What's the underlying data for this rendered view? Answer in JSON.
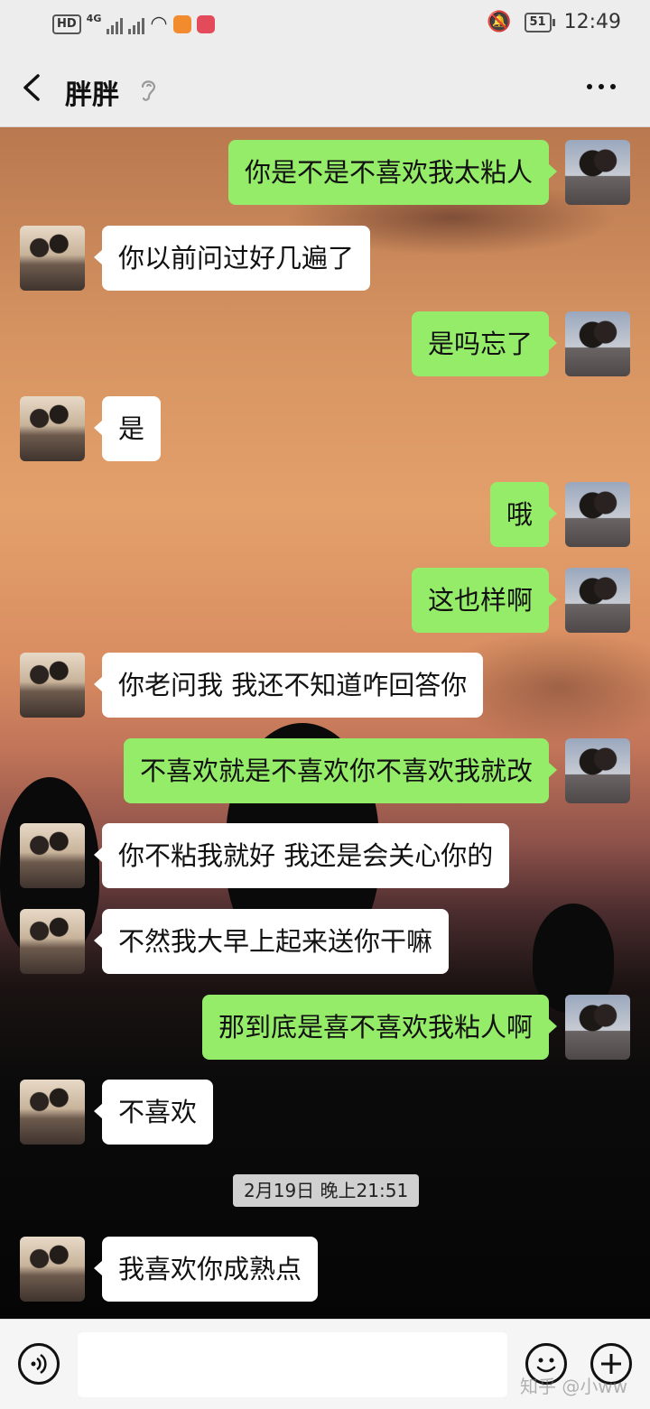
{
  "status_bar": {
    "hd": "HD",
    "network": "4G",
    "battery": "51",
    "time": "12:49"
  },
  "header": {
    "title": "胖胖"
  },
  "messages": [
    {
      "side": "me",
      "text": "你是不是不喜欢我太粘人"
    },
    {
      "side": "other",
      "text": "你以前问过好几遍了"
    },
    {
      "side": "me",
      "text": "是吗忘了"
    },
    {
      "side": "other",
      "text": "是"
    },
    {
      "side": "me",
      "text": "哦"
    },
    {
      "side": "me",
      "text": "这也样啊"
    },
    {
      "side": "other",
      "text": "你老问我 我还不知道咋回答你"
    },
    {
      "side": "me",
      "text": "不喜欢就是不喜欢你不喜欢我就改"
    },
    {
      "side": "other",
      "text": "你不粘我就好 我还是会关心你的"
    },
    {
      "side": "other",
      "text": "不然我大早上起来送你干嘛"
    },
    {
      "side": "me",
      "text": "那到底是喜不喜欢我粘人啊"
    },
    {
      "side": "other",
      "text": "不喜欢"
    },
    {
      "side": "other",
      "text": "我喜欢你成熟点"
    }
  ],
  "timestamp": "2月19日 晚上21:51",
  "input": {
    "value": ""
  },
  "watermark": "知乎 @小ww",
  "colors": {
    "my_bubble": "#95ec69",
    "their_bubble": "#ffffff",
    "header_bg": "#ededed"
  },
  "icons": {
    "back": "chevron-left-icon",
    "voice_mode": "ear-icon",
    "more": "more-dots-icon",
    "voice_input": "voice-icon",
    "emoji": "emoji-icon",
    "plus": "plus-icon"
  }
}
